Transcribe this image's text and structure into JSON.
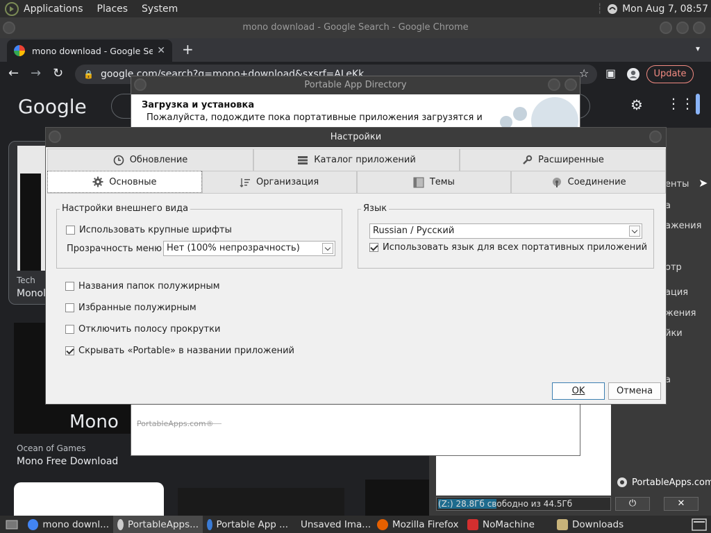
{
  "top_panel": {
    "menus": [
      "Applications",
      "Places",
      "System"
    ],
    "clock": "Mon Aug  7, 08:57"
  },
  "chrome": {
    "window_title": "mono download - Google Search - Google Chrome",
    "tab_title": "mono download - Google Sear",
    "url": "google.com/search?q=mono+download&sxsrf=ALeKk...",
    "update_label": "Update"
  },
  "google": {
    "logo": "Google",
    "result1_source": "Tech",
    "result1_title": "Monol",
    "result2_image_text": "Mono",
    "result2_source": "Ocean of Games",
    "result2_title": "Mono Free Download"
  },
  "pad": {
    "title": "Portable App Directory",
    "heading": "Загрузка и установка",
    "description": "Пожалуйста, подождите пока портативные приложения загрузятся и",
    "footer": "PortableApps.com®"
  },
  "pa_menu": {
    "right_items": [
      "енты",
      "а",
      "ажения",
      "отр",
      "ация",
      "жения",
      "йки",
      "а"
    ],
    "logo": "PortableApps.com",
    "drive_prefix": "(Z:) 28.8Гб св",
    "drive_suffix": "ободно из 44.5Гб",
    "power_label": "⏻",
    "close_label": "✕"
  },
  "settings": {
    "title": "Настройки",
    "tabs_row1": [
      {
        "label": "Обновление",
        "icon": "update-icon"
      },
      {
        "label": "Каталог приложений",
        "icon": "app-catalog-icon"
      },
      {
        "label": "Расширенные",
        "icon": "wrench-icon"
      }
    ],
    "tabs_row2": [
      {
        "label": "Основные",
        "icon": "gear-icon",
        "active": true
      },
      {
        "label": "Организация",
        "icon": "sort-icon"
      },
      {
        "label": "Темы",
        "icon": "themes-icon"
      },
      {
        "label": "Соединение",
        "icon": "connection-icon"
      }
    ],
    "appearance": {
      "title": "Настройки внешнего вида",
      "large_fonts_label": "Использовать крупные шрифты",
      "large_fonts_checked": false,
      "transparency_label": "Прозрачность меню",
      "transparency_value": "Нет (100% непрозрачность)"
    },
    "language": {
      "title": "Язык",
      "value": "Russian / Русский",
      "all_apps_label": "Использовать язык для всех портативных приложений",
      "all_apps_checked": true
    },
    "options": [
      {
        "label": "Названия папок полужирным",
        "checked": false
      },
      {
        "label": "Избранные полужирным",
        "checked": false
      },
      {
        "label": "Отключить полосу прокрутки",
        "checked": false
      },
      {
        "label": "Скрывать «Portable» в названии приложений",
        "checked": true
      }
    ],
    "ok_label": "OK",
    "cancel_label": "Отмена"
  },
  "taskbar": {
    "items": [
      {
        "label": "mono downl...",
        "icon": "chrome-icon",
        "color": "#4285f4"
      },
      {
        "label": "PortableApps...",
        "icon": "portableapps-icon",
        "color": "#cccccc",
        "active": true
      },
      {
        "label": "Portable App ...",
        "icon": "portableapps-directory-icon",
        "color": "#3a7bd5"
      },
      {
        "label": "Unsaved Ima...",
        "icon": "image-editor-icon",
        "color": "#888888"
      },
      {
        "label": "Mozilla Firefox",
        "icon": "firefox-icon",
        "color": "#e66000"
      },
      {
        "label": "NoMachine",
        "icon": "nomachine-icon",
        "color": "#d32f2f"
      },
      {
        "label": "Downloads",
        "icon": "folder-icon",
        "color": "#c8b37a"
      }
    ]
  }
}
